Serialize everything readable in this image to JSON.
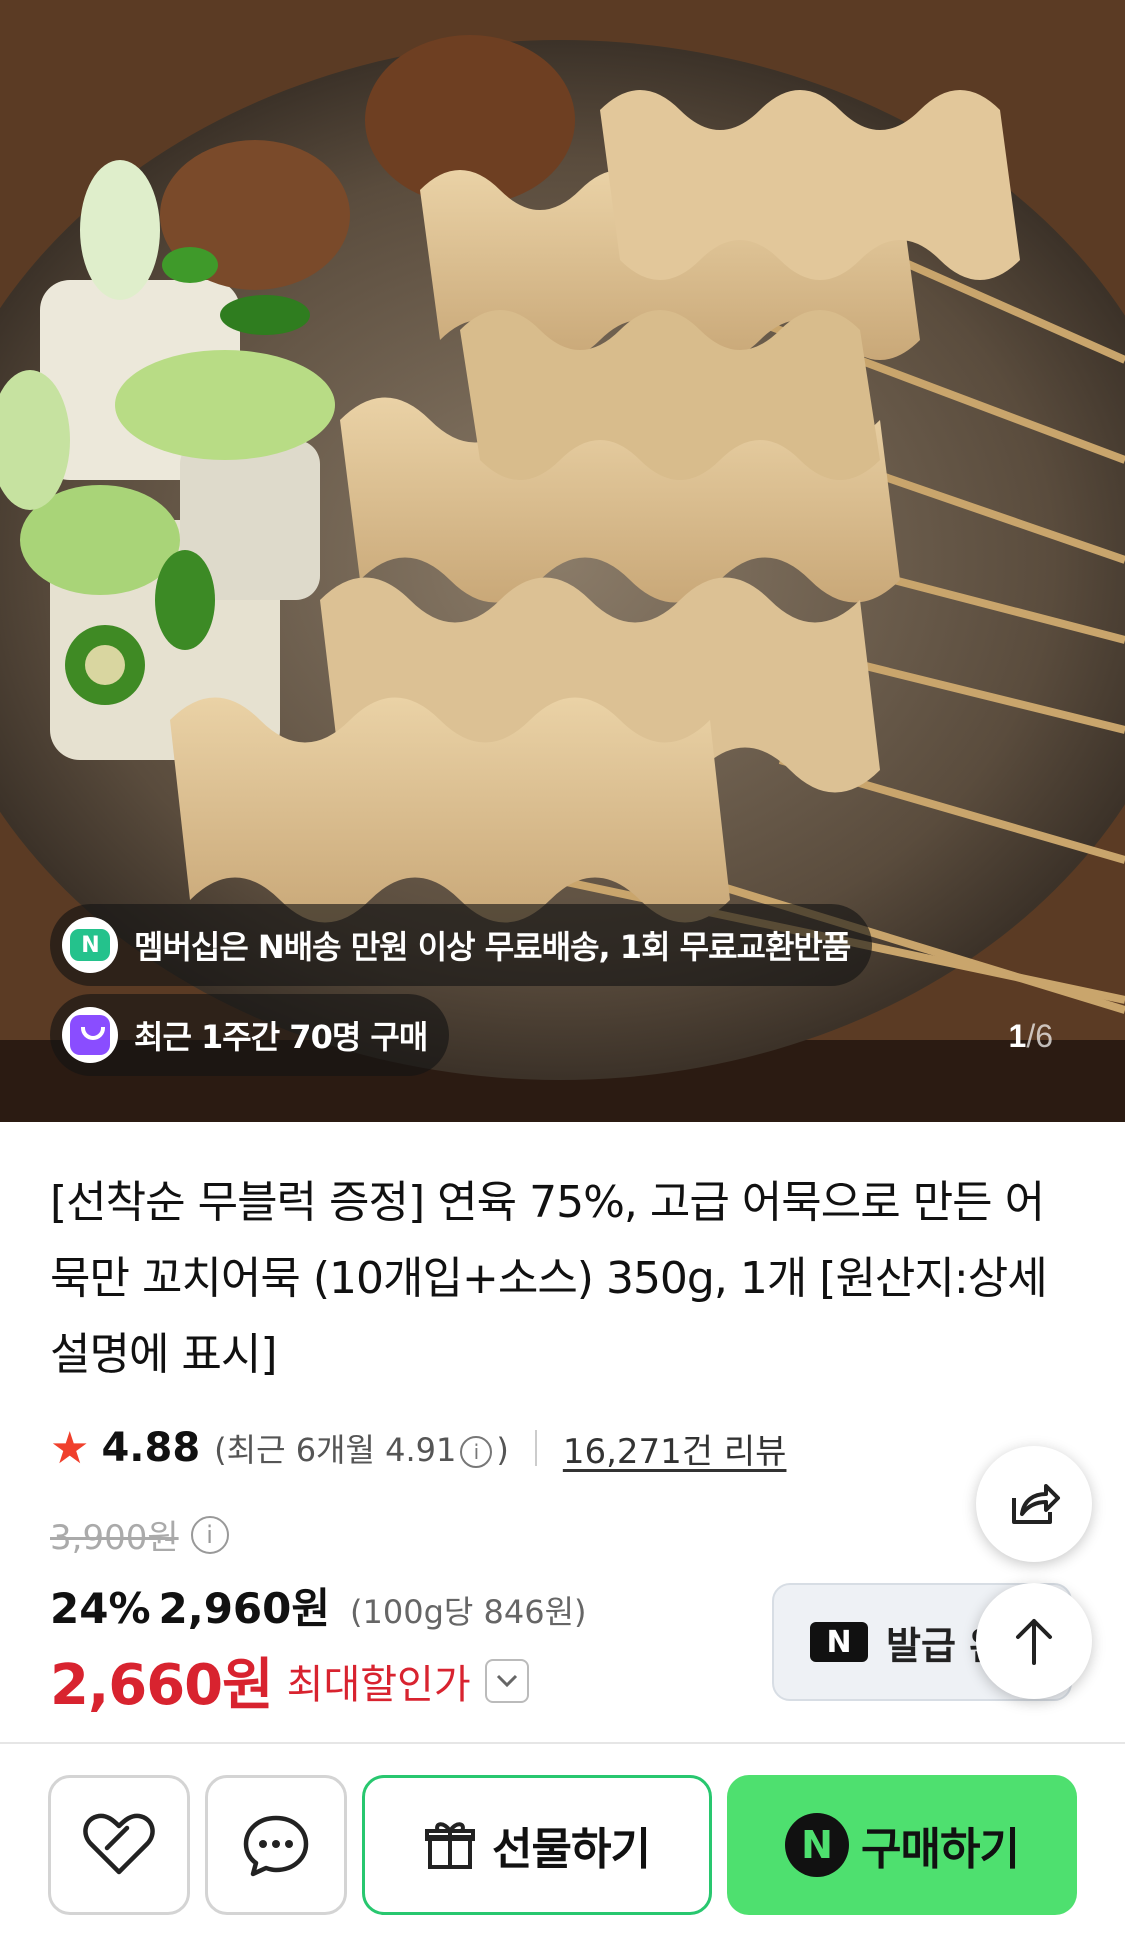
{
  "hero": {
    "membership_badge": "멤버십은 N배송 만원 이상 무료배송, 1회 무료교환반품",
    "membership_icon": "N",
    "recent_badge": "최근 1주간 70명 구매",
    "counter_current": "1",
    "counter_total": "/6"
  },
  "product": {
    "title": "[선착순 무블럭 증정] 연육 75%, 고급 어묵으로 만든 어묵만 꼬치어묵 (10개입+소스) 350g, 1개 [원산지:상세설명에 표시]",
    "rating": "4.88",
    "recent_rating_prefix": "(최근 6개월 4.91",
    "recent_rating_suffix": ")",
    "review_count": "16,271건 리뷰",
    "original_price": "3,900원",
    "discount_rate": "24%",
    "sale_price": "2,960원",
    "unit_price": "(100g당 846원)",
    "best_price": "2,660원",
    "best_price_label": "최대할인가"
  },
  "coupon": {
    "logo": "N",
    "label": "발급 완"
  },
  "bottom_bar": {
    "gift_label": "선물하기",
    "buy_label": "구매하기",
    "buy_logo": "N"
  },
  "colors": {
    "sale_red": "#d8232f",
    "star": "#f0402c",
    "buy_green": "#4ee06f",
    "gift_border": "#28c76f"
  },
  "icons": [
    "info-icon",
    "star-icon",
    "share-icon",
    "arrow-up-icon",
    "heart-icon",
    "chat-icon",
    "gift-icon",
    "chevron-down-icon"
  ]
}
